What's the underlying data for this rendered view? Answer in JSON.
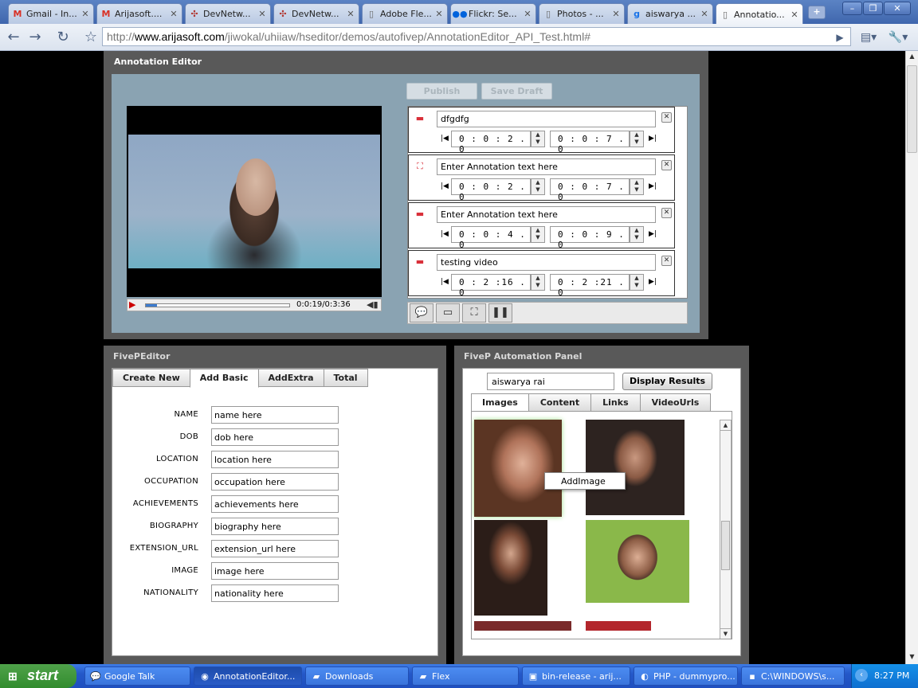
{
  "browser": {
    "tabs": [
      {
        "label": "Gmail - In...",
        "icon": "gmail-icon",
        "glyph": "M",
        "color": "#d93025"
      },
      {
        "label": "Arijasoft....",
        "icon": "gmail-icon",
        "glyph": "M",
        "color": "#d93025"
      },
      {
        "label": "DevNetw...",
        "icon": "devnet-icon",
        "glyph": "✣",
        "color": "#b0302a"
      },
      {
        "label": "DevNetw...",
        "icon": "devnet-icon",
        "glyph": "✣",
        "color": "#b0302a"
      },
      {
        "label": "Adobe Fle...",
        "icon": "page-icon",
        "glyph": "▯",
        "color": "#666666"
      },
      {
        "label": "Flickr: Se...",
        "icon": "flickr-icon",
        "glyph": "●●",
        "color": "#0063dc"
      },
      {
        "label": "Photos - ...",
        "icon": "page-icon",
        "glyph": "▯",
        "color": "#666666"
      },
      {
        "label": "aiswarya ...",
        "icon": "google-icon",
        "glyph": "g",
        "color": "#1a73e8"
      },
      {
        "label": "Annotatio...",
        "icon": "page-icon",
        "glyph": "▯",
        "color": "#666666"
      }
    ],
    "url_prefix": "http://",
    "url_host": "www.arijasoft.com",
    "url_path": "/jiwokal/uhiiaw/hseditor/demos/autofivep/AnnotationEditor_API_Test.html#"
  },
  "annotation_editor": {
    "title": "Annotation Editor",
    "publish_label": "Publish",
    "save_draft_label": "Save Draft",
    "video_time": "0:0:19/0:3:36",
    "progress": 0.08,
    "annotations": [
      {
        "text": "dfgdfg",
        "type": "note-icon",
        "glyph": "▬",
        "color": "#d9303a",
        "start": "0 : 0 : 2 . 0",
        "end": "0 : 0 : 7 . 0"
      },
      {
        "text": "Enter Annotation text here",
        "type": "spotlight-icon",
        "glyph": "⛶",
        "color": "#d9303a",
        "start": "0 : 0 : 2 . 0",
        "end": "0 : 0 : 7 . 0"
      },
      {
        "text": "Enter Annotation text here",
        "type": "speech-bubble-icon",
        "glyph": "▬",
        "color": "#d9303a",
        "start": "0 : 0 : 4 . 0",
        "end": "0 : 0 : 9 . 0"
      },
      {
        "text": "testing video",
        "type": "note-icon",
        "glyph": "▬",
        "color": "#d9303a",
        "start": "0 : 2 :16 . 0",
        "end": "0 : 2 :21 . 0"
      }
    ],
    "tools": [
      {
        "icon": "add-speech-bubble-icon",
        "glyph": "💬"
      },
      {
        "icon": "add-note-icon",
        "glyph": "▭"
      },
      {
        "icon": "add-spotlight-icon",
        "glyph": "⛶"
      },
      {
        "icon": "add-pause-icon",
        "glyph": "❚❚"
      }
    ]
  },
  "fivep_editor": {
    "title": "FivePEditor",
    "tabs": [
      "Create New",
      "Add Basic",
      "AddExtra",
      "Total"
    ],
    "active_tab": "Add Basic",
    "fields": [
      {
        "label": "NAME",
        "value": "name here"
      },
      {
        "label": "DOB",
        "value": "dob here"
      },
      {
        "label": "LOCATION",
        "value": "location here"
      },
      {
        "label": "OCCUPATION",
        "value": "occupation here"
      },
      {
        "label": "ACHIEVEMENTS",
        "value": "achievements here"
      },
      {
        "label": "BIOGRAPHY",
        "value": "biography here"
      },
      {
        "label": "EXTENSION_URL",
        "value": "extension_url here"
      },
      {
        "label": "IMAGE",
        "value": "image here"
      },
      {
        "label": "NATIONALITY",
        "value": "nationality here"
      }
    ]
  },
  "automation_panel": {
    "title": "FiveP Automation Panel",
    "search_value": "aiswarya rai",
    "display_results_label": "Display Results",
    "tabs": [
      "Images",
      "Content",
      "Links",
      "VideoUrls"
    ],
    "active_tab": "Images",
    "context_menu_item": "AddImage"
  },
  "taskbar": {
    "start_label": "start",
    "tasks": [
      {
        "label": "Google Talk",
        "icon": "gtalk-icon",
        "glyph": "💬"
      },
      {
        "label": "AnnotationEditor...",
        "icon": "chrome-icon",
        "glyph": "◉"
      },
      {
        "label": "Downloads",
        "icon": "folder-icon",
        "glyph": "▰"
      },
      {
        "label": "Flex",
        "icon": "folder-icon",
        "glyph": "▰"
      },
      {
        "label": "bin-release - arij...",
        "icon": "explorer-icon",
        "glyph": "▣"
      },
      {
        "label": "PHP - dummypro...",
        "icon": "eclipse-icon",
        "glyph": "◐"
      },
      {
        "label": "C:\\WINDOWS\\s...",
        "icon": "cmd-icon",
        "glyph": "▪"
      }
    ],
    "clock": "8:27 PM"
  }
}
